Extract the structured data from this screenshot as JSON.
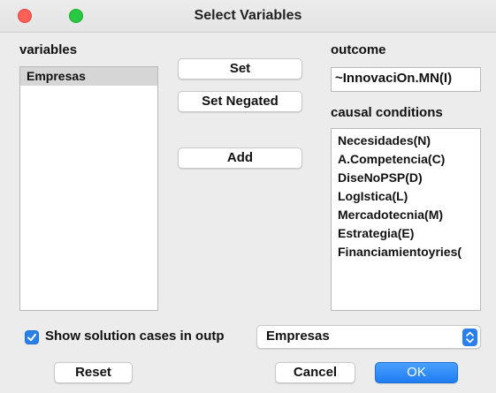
{
  "window": {
    "title": "Select Variables"
  },
  "variables": {
    "label": "variables",
    "items": [
      "Empresas"
    ]
  },
  "buttons": {
    "set": "Set",
    "set_negated": "Set Negated",
    "add": "Add",
    "reset": "Reset",
    "cancel": "Cancel",
    "ok": "OK"
  },
  "outcome": {
    "label": "outcome",
    "value": "~InnovaciOn.MN(I)"
  },
  "conditions": {
    "label": "causal conditions",
    "items": [
      "Necesidades(N)",
      "A.Competencia(C)",
      "DiseNoPSP(D)",
      "LogIstica(L)",
      "Mercadotecnia(M)",
      "Estrategia(E)",
      "Financiamientoyries("
    ]
  },
  "show_cases": {
    "checked": true,
    "label": "Show solution cases in outp",
    "select_value": "Empresas"
  },
  "colors": {
    "accent": "#2b7fe8",
    "close": "#fe5f57",
    "zoom": "#28c840"
  }
}
